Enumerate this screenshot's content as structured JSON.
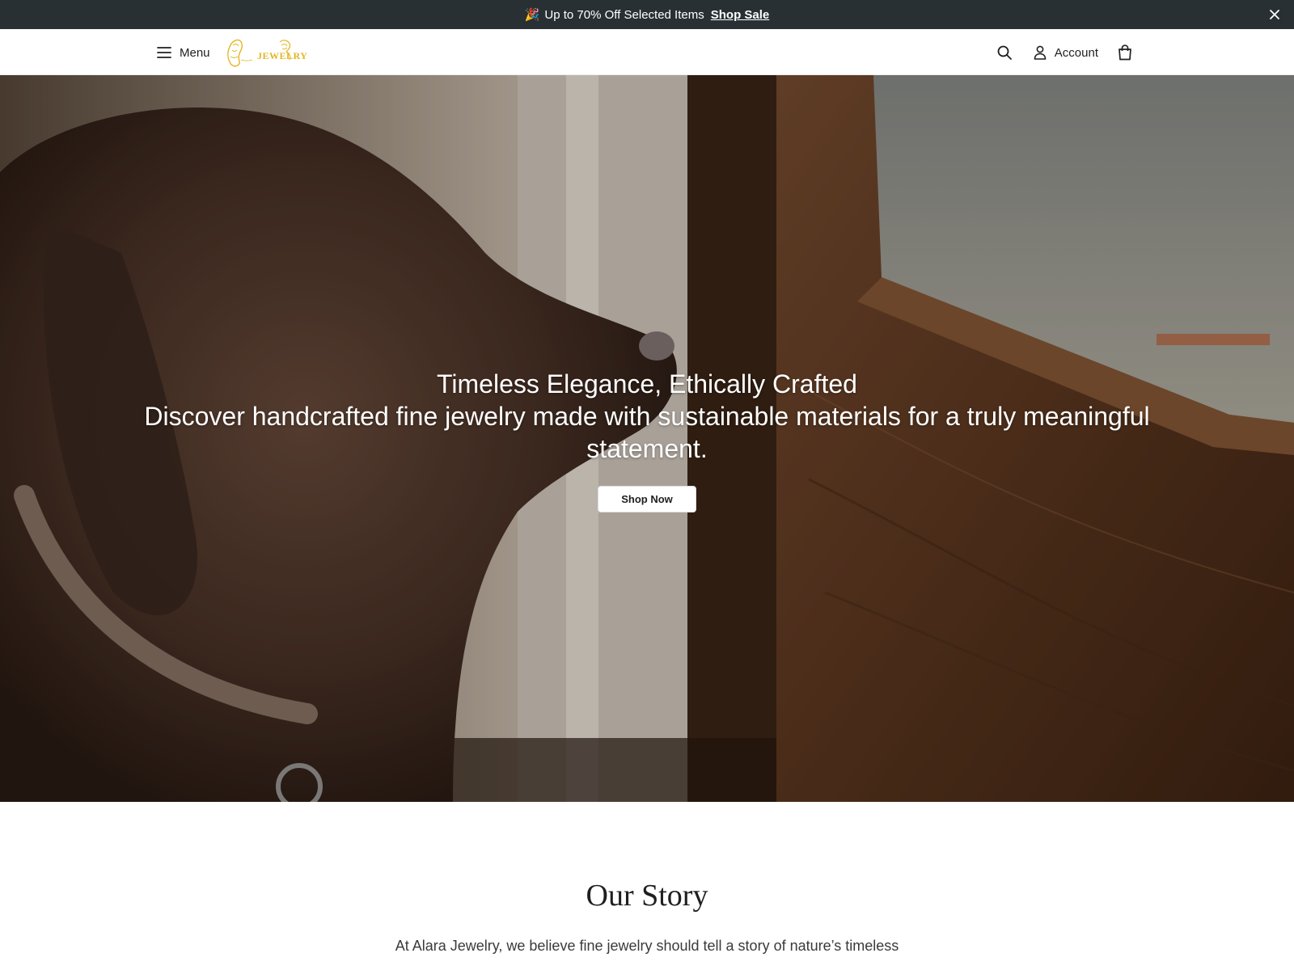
{
  "announcement": {
    "icon": "party-popper-icon",
    "emoji": "🎉",
    "text": "Up to 70% Off Selected Items",
    "link_label": "Shop Sale",
    "close_icon": "close-icon"
  },
  "header": {
    "menu_label": "Menu",
    "logo_text": "JEWELRY",
    "logo_color": "#e3b621",
    "account_label": "Account",
    "icons": [
      "hamburger-icon",
      "search-icon",
      "user-icon",
      "shopping-bag-icon"
    ]
  },
  "hero": {
    "title": "Timeless Elegance, Ethically Crafted",
    "subtitle": "Discover handcrafted fine jewelry made with sustainable materials for a truly meaningful statement.",
    "cta_label": "Shop Now"
  },
  "story": {
    "title": "Our Story",
    "body": "At Alara Jewelry, we believe fine jewelry should tell a story of nature’s timeless"
  },
  "colors": {
    "announcement_bg": "#283034",
    "accent_gold": "#e3b621",
    "text_dark": "#1f1f1f"
  }
}
